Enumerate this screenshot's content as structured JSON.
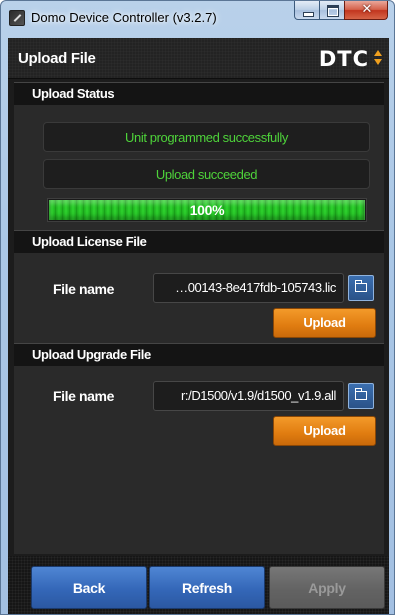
{
  "window": {
    "title": "Domo Device Controller (v3.2.7)",
    "controls": {
      "close_glyph": "✕"
    }
  },
  "header": {
    "title": "Upload File",
    "logo": "DTC"
  },
  "upload_status": {
    "heading": "Upload Status",
    "line1": "Unit programmed successfully",
    "line2": "Upload succeeded",
    "progress_fraction": 1.0,
    "progress_label": "100%"
  },
  "license_section": {
    "heading": "Upload License File",
    "field_label": "File name",
    "file_value": "…00143-8e417fdb-105743.lic",
    "upload_label": "Upload"
  },
  "upgrade_section": {
    "heading": "Upload Upgrade File",
    "field_label": "File name",
    "file_value": "r:/D1500/v1.9/d1500_v1.9.all",
    "upload_label": "Upload"
  },
  "footer": {
    "back_label": "Back",
    "refresh_label": "Refresh",
    "apply_label": "Apply"
  },
  "icons": [
    "app-icon",
    "minimize-icon",
    "maximize-icon",
    "close-icon",
    "logo-arrows-icon",
    "folder-icon"
  ],
  "colors": {
    "status_green": "#4ed33a",
    "progress_green": "#2ed42e",
    "upload_orange": "#e07c10",
    "footer_blue": "#3467b8",
    "logo_accent": "#f0a01e"
  }
}
